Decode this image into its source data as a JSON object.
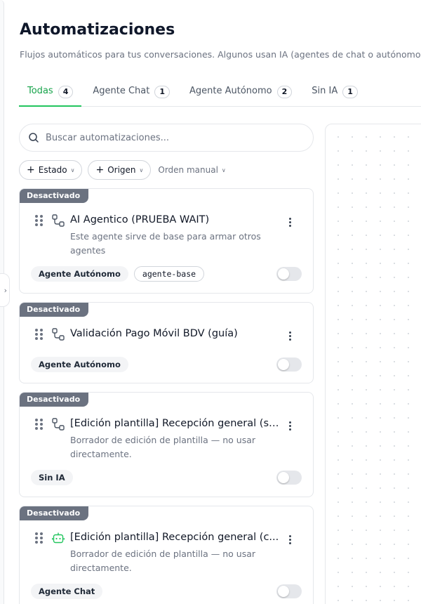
{
  "header": {
    "title": "Automatizaciones",
    "subtitle": "Flujos automáticos para tus conversaciones. Algunos usan IA (agentes de chat o autónomos);"
  },
  "tabs": [
    {
      "label": "Todas",
      "count": "4",
      "active": true
    },
    {
      "label": "Agente Chat",
      "count": "1",
      "active": false
    },
    {
      "label": "Agente Autónomo",
      "count": "2",
      "active": false
    },
    {
      "label": "Sin IA",
      "count": "1",
      "active": false
    }
  ],
  "search": {
    "placeholder": "Buscar automatizaciones...",
    "value": ""
  },
  "filters": {
    "estado_label": "Estado",
    "origen_label": "Origen",
    "sort_label": "Orden manual"
  },
  "cards": [
    {
      "status": "Desactivado",
      "icon": "workflow-icon",
      "title": "AI Agentico (PRUEBA WAIT)",
      "description": "Este agente sirve de base para armar otros agentes",
      "tags": [
        "Agente Autónomo"
      ],
      "code_tag": "agente-base",
      "enabled": false
    },
    {
      "status": "Desactivado",
      "icon": "workflow-icon",
      "title": "Validación Pago Móvil BDV (guía)",
      "description": "",
      "tags": [
        "Agente Autónomo"
      ],
      "enabled": false
    },
    {
      "status": "Desactivado",
      "icon": "workflow-icon",
      "title": "[Edición plantilla] Recepción general (si...",
      "description": "Borrador de edición de plantilla — no usar directamente.",
      "tags": [
        "Sin IA"
      ],
      "enabled": false
    },
    {
      "status": "Desactivado",
      "icon": "bot-icon",
      "title": "[Edición plantilla] Recepción general (c...",
      "description": "Borrador de edición de plantilla — no usar directamente.",
      "tags": [
        "Agente Chat"
      ],
      "enabled": false
    }
  ],
  "colors": {
    "accent": "#22c55e",
    "status_badge": "#6b7280",
    "bot_icon": "#22c55e"
  }
}
